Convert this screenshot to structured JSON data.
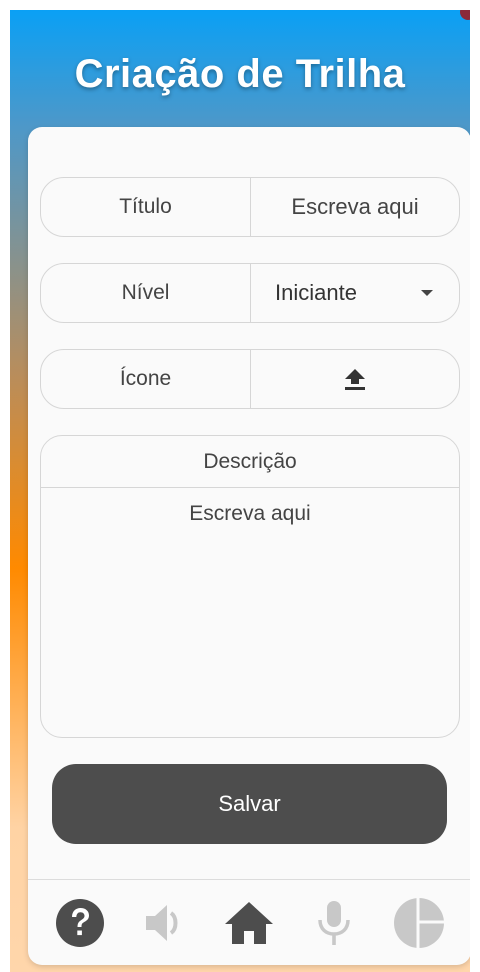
{
  "header": {
    "title": "Criação de Trilha"
  },
  "form": {
    "titulo": {
      "label": "Título",
      "placeholder": "Escreva aqui"
    },
    "nivel": {
      "label": "Nível",
      "value": "Iniciante"
    },
    "icone": {
      "label": "Ícone",
      "icon": "upload-icon"
    },
    "descricao": {
      "label": "Descrição",
      "placeholder": "Escreva aqui"
    },
    "save_label": "Salvar"
  },
  "bottom_nav": {
    "items": [
      {
        "icon": "help-icon",
        "state": "active"
      },
      {
        "icon": "speaker-icon",
        "state": "inactive"
      },
      {
        "icon": "home-icon",
        "state": "active"
      },
      {
        "icon": "microphone-icon",
        "state": "inactive"
      },
      {
        "icon": "pie-chart-icon",
        "state": "inactive"
      }
    ]
  },
  "colors": {
    "primary_dark": "#4d4d4d",
    "inactive_icon": "#c8c8c8",
    "card_bg": "#fafafa",
    "gradient_top": "#0aa0f5",
    "gradient_mid": "#ff8a00",
    "gradient_bottom": "#ffd6ab"
  }
}
